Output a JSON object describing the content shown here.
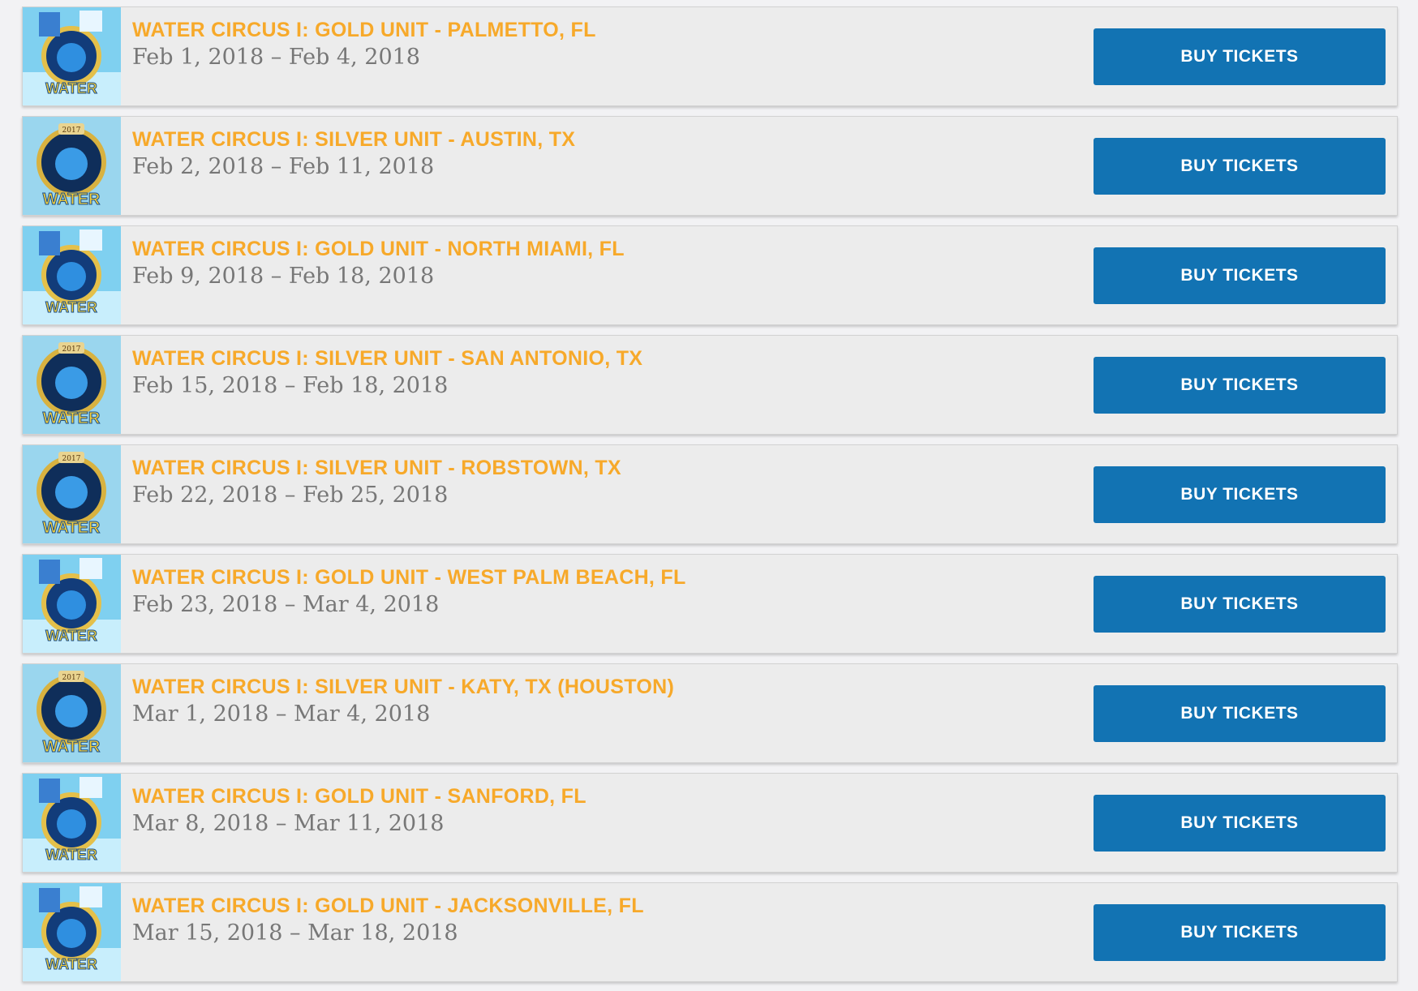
{
  "events": [
    {
      "title": "WATER CIRCUS I: GOLD UNIT - PALMETTO, FL",
      "dates": "Feb 1, 2018 – Feb 4, 2018",
      "button": "BUY TICKETS",
      "thumbnail": "water-circus-gold-poster"
    },
    {
      "title": "WATER CIRCUS I: SILVER UNIT - AUSTIN, TX",
      "dates": "Feb 2, 2018 – Feb 11, 2018",
      "button": "BUY TICKETS",
      "thumbnail": "water-circus-silver-poster"
    },
    {
      "title": "WATER CIRCUS I: GOLD UNIT - NORTH MIAMI, FL",
      "dates": "Feb 9, 2018 – Feb 18, 2018",
      "button": "BUY TICKETS",
      "thumbnail": "water-circus-gold-poster"
    },
    {
      "title": "WATER CIRCUS I: SILVER UNIT - SAN ANTONIO, TX",
      "dates": "Feb 15, 2018 – Feb 18, 2018",
      "button": "BUY TICKETS",
      "thumbnail": "water-circus-silver-poster"
    },
    {
      "title": "WATER CIRCUS I: SILVER UNIT - ROBSTOWN, TX",
      "dates": "Feb 22, 2018 – Feb 25, 2018",
      "button": "BUY TICKETS",
      "thumbnail": "water-circus-silver-poster"
    },
    {
      "title": "WATER CIRCUS I: GOLD UNIT - WEST PALM BEACH, FL",
      "dates": "Feb 23, 2018 – Mar 4, 2018",
      "button": "BUY TICKETS",
      "thumbnail": "water-circus-gold-poster"
    },
    {
      "title": "WATER CIRCUS I: SILVER UNIT - KATY, TX (HOUSTON)",
      "dates": "Mar 1, 2018 – Mar 4, 2018",
      "button": "BUY TICKETS",
      "thumbnail": "water-circus-silver-poster"
    },
    {
      "title": "WATER CIRCUS I: GOLD UNIT - SANFORD, FL",
      "dates": "Mar 8, 2018 – Mar 11, 2018",
      "button": "BUY TICKETS",
      "thumbnail": "water-circus-gold-poster"
    },
    {
      "title": "WATER CIRCUS I: GOLD UNIT - JACKSONVILLE, FL",
      "dates": "Mar 15, 2018 – Mar 18, 2018",
      "button": "BUY TICKETS",
      "thumbnail": "water-circus-gold-poster"
    }
  ],
  "colors": {
    "title": "#f7a92a",
    "dates": "#777777",
    "button": "#1273b3",
    "row_bg": "#ececec"
  }
}
